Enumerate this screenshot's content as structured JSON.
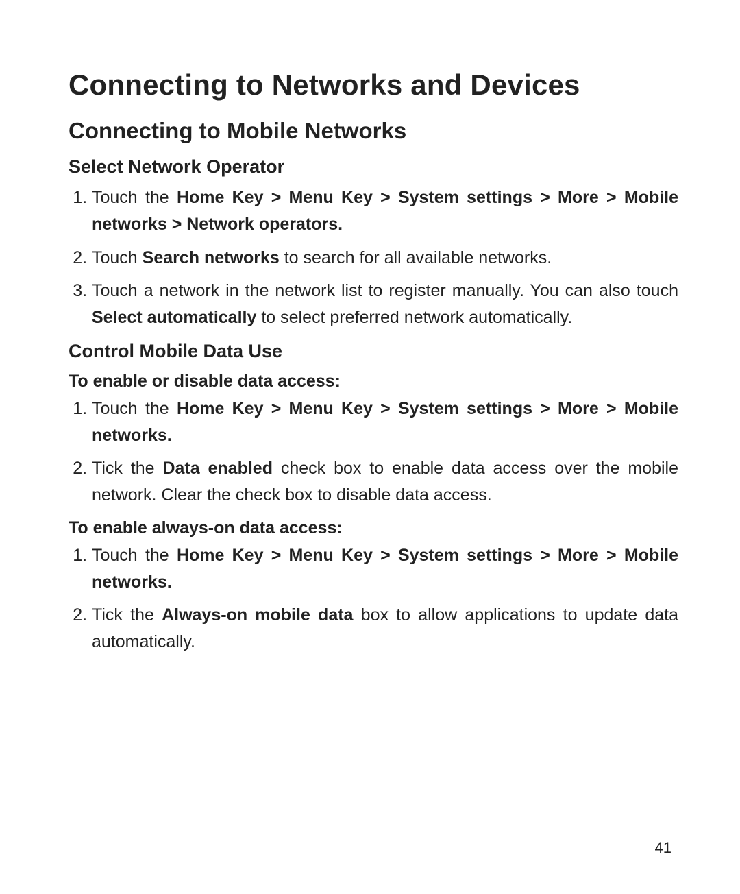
{
  "page_number": "41",
  "chapter_title": "Connecting to Networks and Devices",
  "section_title": "Connecting to Mobile Networks",
  "sub1_title": "Select Network Operator",
  "sub1_steps": {
    "s1_a": "Touch the ",
    "s1_b": "Home Key > Menu Key > System settings > More > Mobile networks > Network operators.",
    "s2_a": "Touch ",
    "s2_b": "Search networks",
    "s2_c": " to search for all available networks.",
    "s3_a": "Touch a network in the network list to register manually. You can also touch ",
    "s3_b": "Select automatically",
    "s3_c": " to select preferred network automatically."
  },
  "sub2_title": "Control Mobile Data Use",
  "sub2_label1": "To enable or disable data access:",
  "sub2_steps1": {
    "s1_a": "Touch the ",
    "s1_b": "Home Key > Menu Key > System settings > More > Mobile networks.",
    "s2_a": "Tick the ",
    "s2_b": "Data enabled",
    "s2_c": " check box to enable data access over the mobile network. Clear the check box to disable data access."
  },
  "sub2_label2": "To enable always-on data access:",
  "sub2_steps2": {
    "s1_a": "Touch the ",
    "s1_b": "Home Key > Menu Key > System settings > More > Mobile networks.",
    "s2_a": "Tick the ",
    "s2_b": "Always-on mobile data",
    "s2_c": " box to allow applications to update data automatically."
  }
}
